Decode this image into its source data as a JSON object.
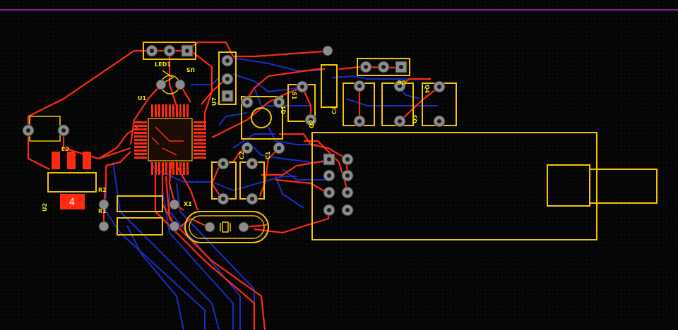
{
  "board": {
    "colors": {
      "background": "#050505",
      "top_copper": "#ff2a10",
      "bottom_copper": "#1a2cc8",
      "silkscreen": "#f2c400",
      "component_label": "#f2e600",
      "board_edge": "#8a1e8a",
      "via": "#8c8c8c"
    },
    "designators": {
      "led1": "LED1",
      "u5": "U5",
      "u1": "U1",
      "u7": "U7",
      "u2": "U2",
      "c3": "C3",
      "c2": "C2",
      "c1": "C1",
      "r1": "R1",
      "r2": "R2",
      "x1": "X1",
      "s1": "S1",
      "u6": "U6",
      "c4": "C4",
      "q1": "Q1",
      "q2": "Q2",
      "q3": "Q3",
      "q4": "Q4"
    },
    "selected_pad_number": "4"
  }
}
